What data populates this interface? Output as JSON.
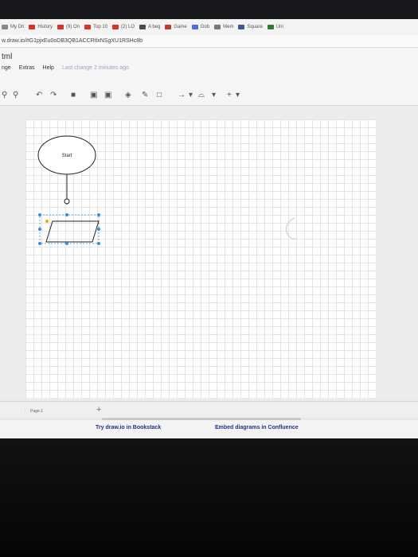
{
  "bookmarks": [
    {
      "label": "My Dri",
      "color": "#888"
    },
    {
      "label": "History",
      "color": "#d9322b"
    },
    {
      "label": "(9) On",
      "color": "#d9322b"
    },
    {
      "label": "Top 10",
      "color": "#d9322b"
    },
    {
      "label": "(2) LO",
      "color": "#d9322b"
    },
    {
      "label": "A beg",
      "color": "#4a4a4a"
    },
    {
      "label": "Game",
      "color": "#c0392b"
    },
    {
      "label": "Gob",
      "color": "#4a6fd8"
    },
    {
      "label": "Mem",
      "color": "#777"
    },
    {
      "label": "Square",
      "color": "#3b5998"
    },
    {
      "label": "Uni",
      "color": "#2e7d32"
    }
  ],
  "address": {
    "url": "w.draw.io/#G1pjxEu0oDB3QB1ACCRtlxNSgXU1RSHc8b"
  },
  "doc": {
    "title": "tml"
  },
  "menu": {
    "items": [
      "nge",
      "Extras",
      "Help"
    ],
    "last_change": "Last change 2 minutes ago"
  },
  "diagram": {
    "start_label": "Start"
  },
  "footer": {
    "page_tab": "Page-1",
    "add_page": "+",
    "promo_left": "Try draw.io in Bookstack",
    "promo_right": "Embed diagrams in Confluence"
  },
  "colors": {
    "selection": "#3b8fd6",
    "link": "#26308f"
  }
}
